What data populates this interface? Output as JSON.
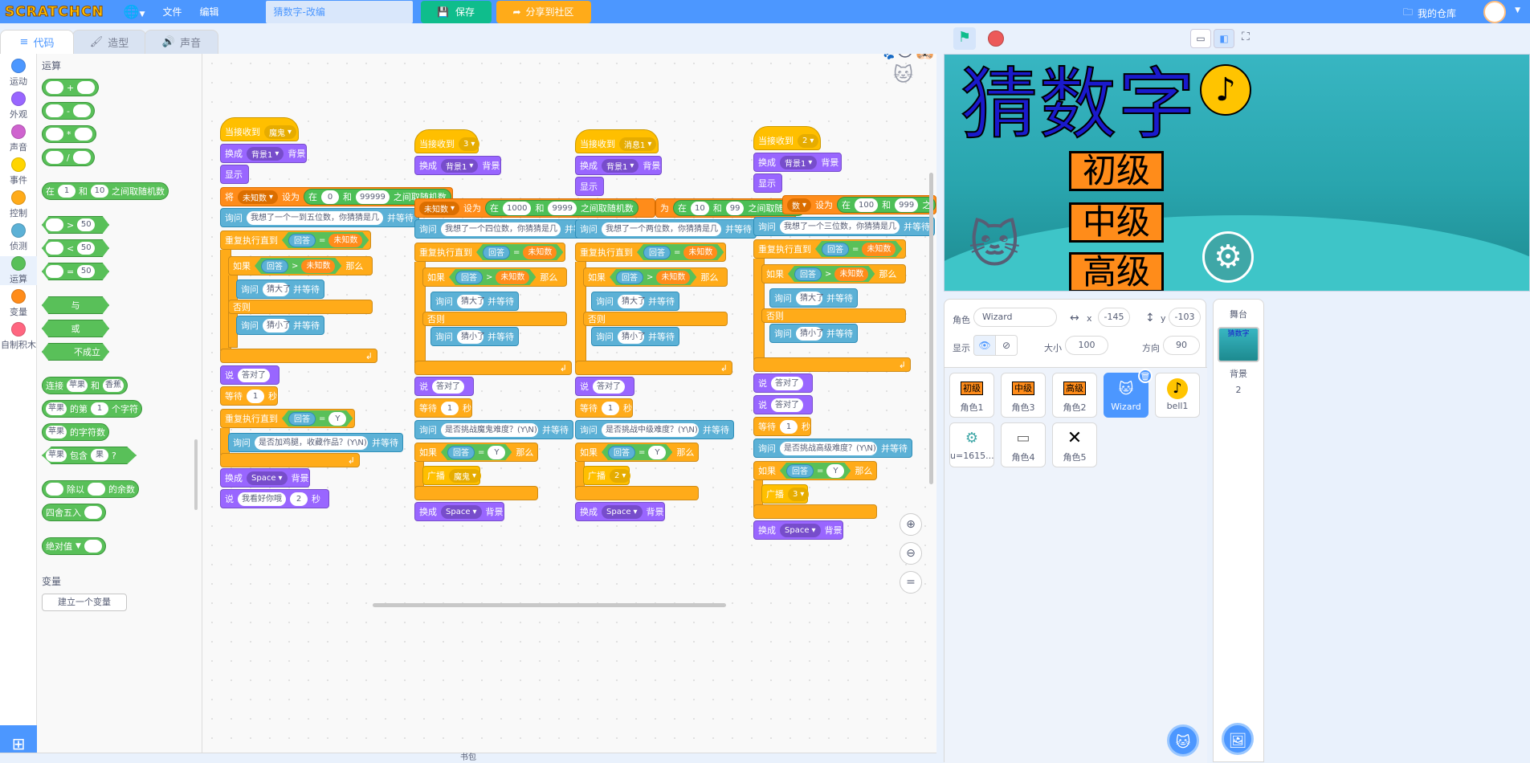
{
  "menu": {
    "logo": "SCRATCHCN",
    "file": "文件",
    "edit": "编辑",
    "project_name": "猜数字-改编",
    "save": "保存",
    "share": "分享到社区",
    "my_stuff": "我的仓库"
  },
  "tabs": {
    "code": "代码",
    "costumes": "造型",
    "sounds": "声音"
  },
  "categories": [
    {
      "label": "运动",
      "color": "#4c97ff"
    },
    {
      "label": "外观",
      "color": "#9966ff"
    },
    {
      "label": "声音",
      "color": "#cf63cf"
    },
    {
      "label": "事件",
      "color": "#ffd500"
    },
    {
      "label": "控制",
      "color": "#ffab19"
    },
    {
      "label": "侦测",
      "color": "#5cb1d6"
    },
    {
      "label": "运算",
      "color": "#59c059"
    },
    {
      "label": "变量",
      "color": "#ff8c1a"
    },
    {
      "label": "自制积木",
      "color": "#ff6680"
    }
  ],
  "palette": {
    "section": "运算",
    "add": "+",
    "sub": "-",
    "mul": "*",
    "div": "/",
    "random": {
      "pre": "在",
      "a": "1",
      "mid": "和",
      "b": "10",
      "post": "之间取随机数"
    },
    "gt": ">",
    "lt": "<",
    "eq": "=",
    "cmp_val": "50",
    "and": "与",
    "or": "或",
    "not": "不成立",
    "join": {
      "pre": "连接",
      "a": "苹果",
      "mid": "和",
      "b": "香蕉"
    },
    "letter": {
      "a": "苹果",
      "mid": "的第",
      "n": "1",
      "post": "个字符"
    },
    "length": {
      "a": "苹果",
      "post": "的字符数"
    },
    "contains": {
      "a": "苹果",
      "mid": "包含",
      "b": "果",
      "q": "?"
    },
    "mod": {
      "mid": "除以",
      "post": "的余数"
    },
    "round": "四舍五入",
    "abs": "绝对值",
    "var_section": "变量",
    "make_var": "建立一个变量"
  },
  "scripts": {
    "s1": {
      "hat": "当接收到",
      "hat_val": "魔鬼",
      "switch": "换成",
      "bg1": "背景1",
      "bg": "背景",
      "show": "显示",
      "set": "将",
      "var": "未知数",
      "set_to": "设为",
      "rand_pre": "在",
      "r_a": "0",
      "r_mid": "和",
      "r_b": "99999",
      "rand_post": "之间取随机数",
      "ask": "询问",
      "ask_text": "我想了一个一到五位数，你猜猜是几",
      "wait": "并等待",
      "repeat": "重复执行直到",
      "answer": "回答",
      "eq": "=",
      "if": "如果",
      "gt": ">",
      "then": "那么",
      "big": "猜大了",
      "else": "否则",
      "small": "猜小了",
      "say": "说",
      "right": "答对了",
      "wait_s": "等待",
      "one": "1",
      "sec": "秒",
      "y": "Y",
      "ask2": "是否加鸡腿，收藏作品？(Y\\N)",
      "space": "Space",
      "say_for": "我看好你哦",
      "two": "2"
    },
    "s2": {
      "hat_val": "3",
      "set_var": "未知数",
      "r_a": "1000",
      "r_b": "9999",
      "ask_text": "我想了一个四位数，你猜猜是几",
      "ask2": "是否挑战魔鬼难度？(Y\\N)",
      "broadcast": "广播",
      "bc_val": "魔鬼"
    },
    "s3": {
      "hat_val": "消息1",
      "r_pre": "为",
      "r_a": "10",
      "r_b": "99",
      "ask_text": "我想了一个两位数，你猜猜是几",
      "ask2": "是否挑战中级难度？(Y\\N)",
      "bc_val": "2"
    },
    "s4": {
      "hat_val": "2",
      "set_var": "数",
      "r_a": "100",
      "r_b": "999",
      "r_post": "之",
      "ask_text": "我想了一个三位数，你猜猜是几",
      "ask2": "是否挑战高级难度？(Y\\N)",
      "bc_val": "3"
    }
  },
  "stage": {
    "title": "猜数字",
    "lvl1": "初级",
    "lvl2": "中级",
    "lvl3": "高级"
  },
  "sprite_info": {
    "sprite_label": "角色",
    "sprite_name": "Wizard",
    "x_label": "x",
    "x": "-145",
    "y_label": "y",
    "y": "-103",
    "show_label": "显示",
    "size_label": "大小",
    "size": "100",
    "dir_label": "方向",
    "dir": "90"
  },
  "sprites": [
    {
      "name": "角色1",
      "thumb": "初级"
    },
    {
      "name": "角色3",
      "thumb": "中级"
    },
    {
      "name": "角色2",
      "thumb": "高级"
    },
    {
      "name": "Wizard",
      "thumb": "🐱"
    },
    {
      "name": "bell1",
      "thumb": "♪"
    },
    {
      "name": "u=1615...",
      "thumb": "⚙"
    },
    {
      "name": "角色4",
      "thumb": "▭"
    },
    {
      "name": "角色5",
      "thumb": "✕"
    }
  ],
  "stage_panel": {
    "title": "舞台",
    "bd_label": "背景",
    "bd_count": "2",
    "bd_thumb": "猜数字"
  },
  "backpack": "书包"
}
